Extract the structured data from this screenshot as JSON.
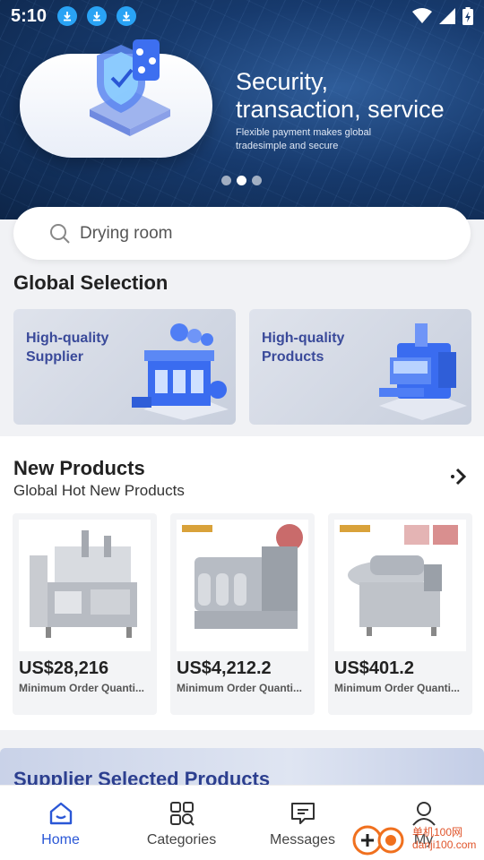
{
  "status": {
    "time": "5:10"
  },
  "banner": {
    "title_line1": "Security,",
    "title_line2": "transaction, service",
    "subtitle": "Flexible payment makes global tradesimple and secure",
    "slides": 3,
    "active_slide": 2
  },
  "search": {
    "placeholder": "Drying room"
  },
  "global_selection": {
    "title": "Global Selection",
    "cards": [
      {
        "label": "High-quality Supplier"
      },
      {
        "label": "High-quality Products"
      }
    ]
  },
  "new_products": {
    "title": "New Products",
    "subtitle": "Global Hot New Products",
    "items": [
      {
        "price": "US$28,216",
        "moq": "Minimum Order Quanti..."
      },
      {
        "price": "US$4,212.2",
        "moq": "Minimum Order Quanti..."
      },
      {
        "price": "US$401.2",
        "moq": "Minimum Order Quanti..."
      }
    ]
  },
  "supplier_section": {
    "title": "Supplier Selected Products"
  },
  "tabbar": {
    "tabs": [
      {
        "label": "Home",
        "icon": "home-icon",
        "active": true
      },
      {
        "label": "Categories",
        "icon": "categories-icon",
        "active": false
      },
      {
        "label": "Messages",
        "icon": "messages-icon",
        "active": false
      },
      {
        "label": "My",
        "icon": "profile-icon",
        "active": false
      }
    ]
  },
  "watermark": {
    "line1": "单机100网",
    "line2": "danji100.com"
  },
  "colors": {
    "accent": "#2a57d6",
    "banner": "#173a6d",
    "supplier_title": "#2c3f8f"
  }
}
